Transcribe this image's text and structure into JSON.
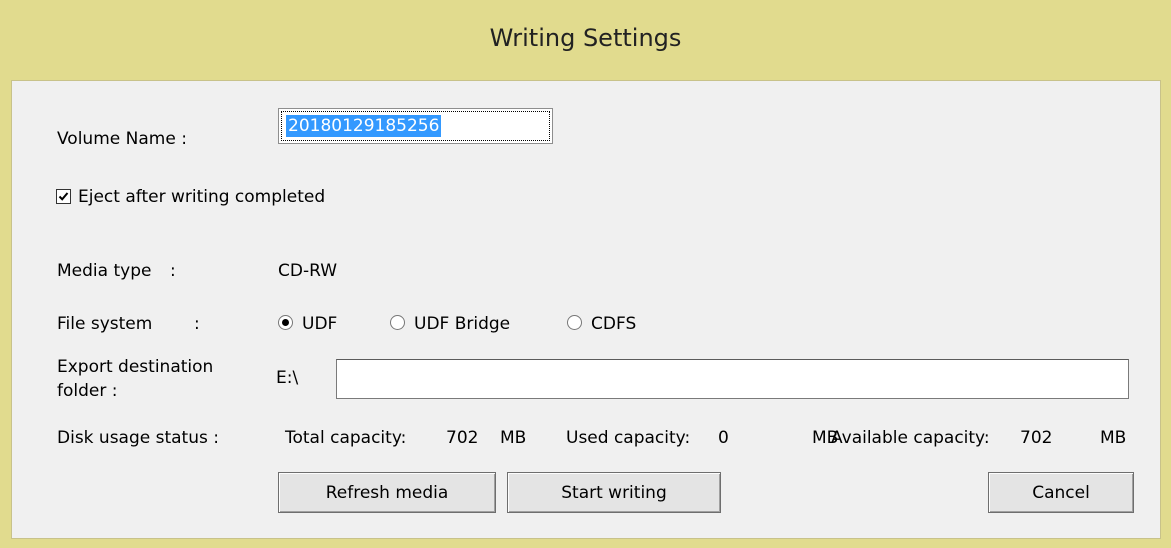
{
  "window": {
    "title": "Writing Settings"
  },
  "volume": {
    "label": "Volume Name :",
    "value": "20180129185256"
  },
  "eject": {
    "label": "Eject after writing completed",
    "checked": true
  },
  "media": {
    "label": "Media type",
    "colon": ":",
    "value": "CD-RW"
  },
  "filesystem": {
    "label": "File system",
    "colon": ":",
    "options": [
      {
        "label": "UDF",
        "selected": true
      },
      {
        "label": "UDF Bridge",
        "selected": false
      },
      {
        "label": "CDFS",
        "selected": false
      }
    ]
  },
  "export": {
    "label_line1": "Export destination",
    "label_line2": "folder :",
    "drive": "E:\\",
    "path": ""
  },
  "disk": {
    "label": "Disk usage status :",
    "total_label": "Total capacity:",
    "total_value": "702",
    "total_unit": "MB",
    "used_label": "Used capacity:",
    "used_value": "0",
    "used_unit": "MB",
    "available_label": "Available capacity:",
    "available_value": "702",
    "available_unit": "MB"
  },
  "buttons": {
    "refresh": "Refresh media",
    "start": "Start writing",
    "cancel": "Cancel"
  },
  "colors": {
    "frame": "#e1db8e",
    "client": "#f0f0f0",
    "selection": "#3399ff"
  }
}
